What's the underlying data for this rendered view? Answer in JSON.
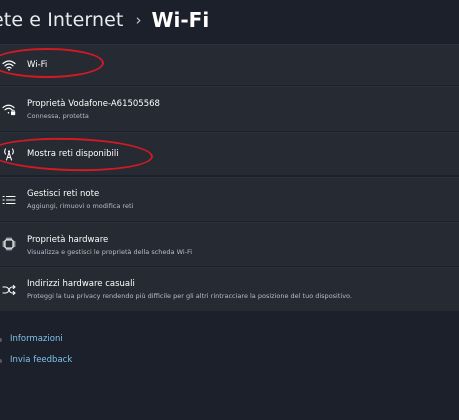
{
  "breadcrumb": {
    "parent": "ete e Internet",
    "separator": "›",
    "current": "Wi-Fi"
  },
  "rows": {
    "wifi": {
      "title": "Wi-Fi",
      "icon": "wifi-icon"
    },
    "properties": {
      "title": "Proprietà Vodafone-A61505568",
      "subtitle": "Connessa, protetta",
      "icon": "wifi-lock-icon"
    },
    "available": {
      "title": "Mostra reti disponibili",
      "icon": "antenna-icon"
    },
    "known": {
      "title": "Gestisci reti note",
      "subtitle": "Aggiungi, rimuovi o modifica reti",
      "icon": "list-icon"
    },
    "hardware": {
      "title": "Proprietà hardware",
      "subtitle": "Visualizza e gestisci le proprietà della scheda Wi-Fi",
      "icon": "chip-icon"
    },
    "random": {
      "title": "Indirizzi hardware casuali",
      "subtitle": "Proteggi la tua privacy rendendo più difficile per gli altri rintracciare la posizione del tuo dispositivo.",
      "icon": "shuffle-icon"
    }
  },
  "footer": {
    "info": "Informazioni",
    "feedback": "Invia feedback"
  },
  "colors": {
    "background": "#1c202a",
    "card": "#262a33",
    "link": "#7fc2ee",
    "annotation": "#d11a24"
  }
}
